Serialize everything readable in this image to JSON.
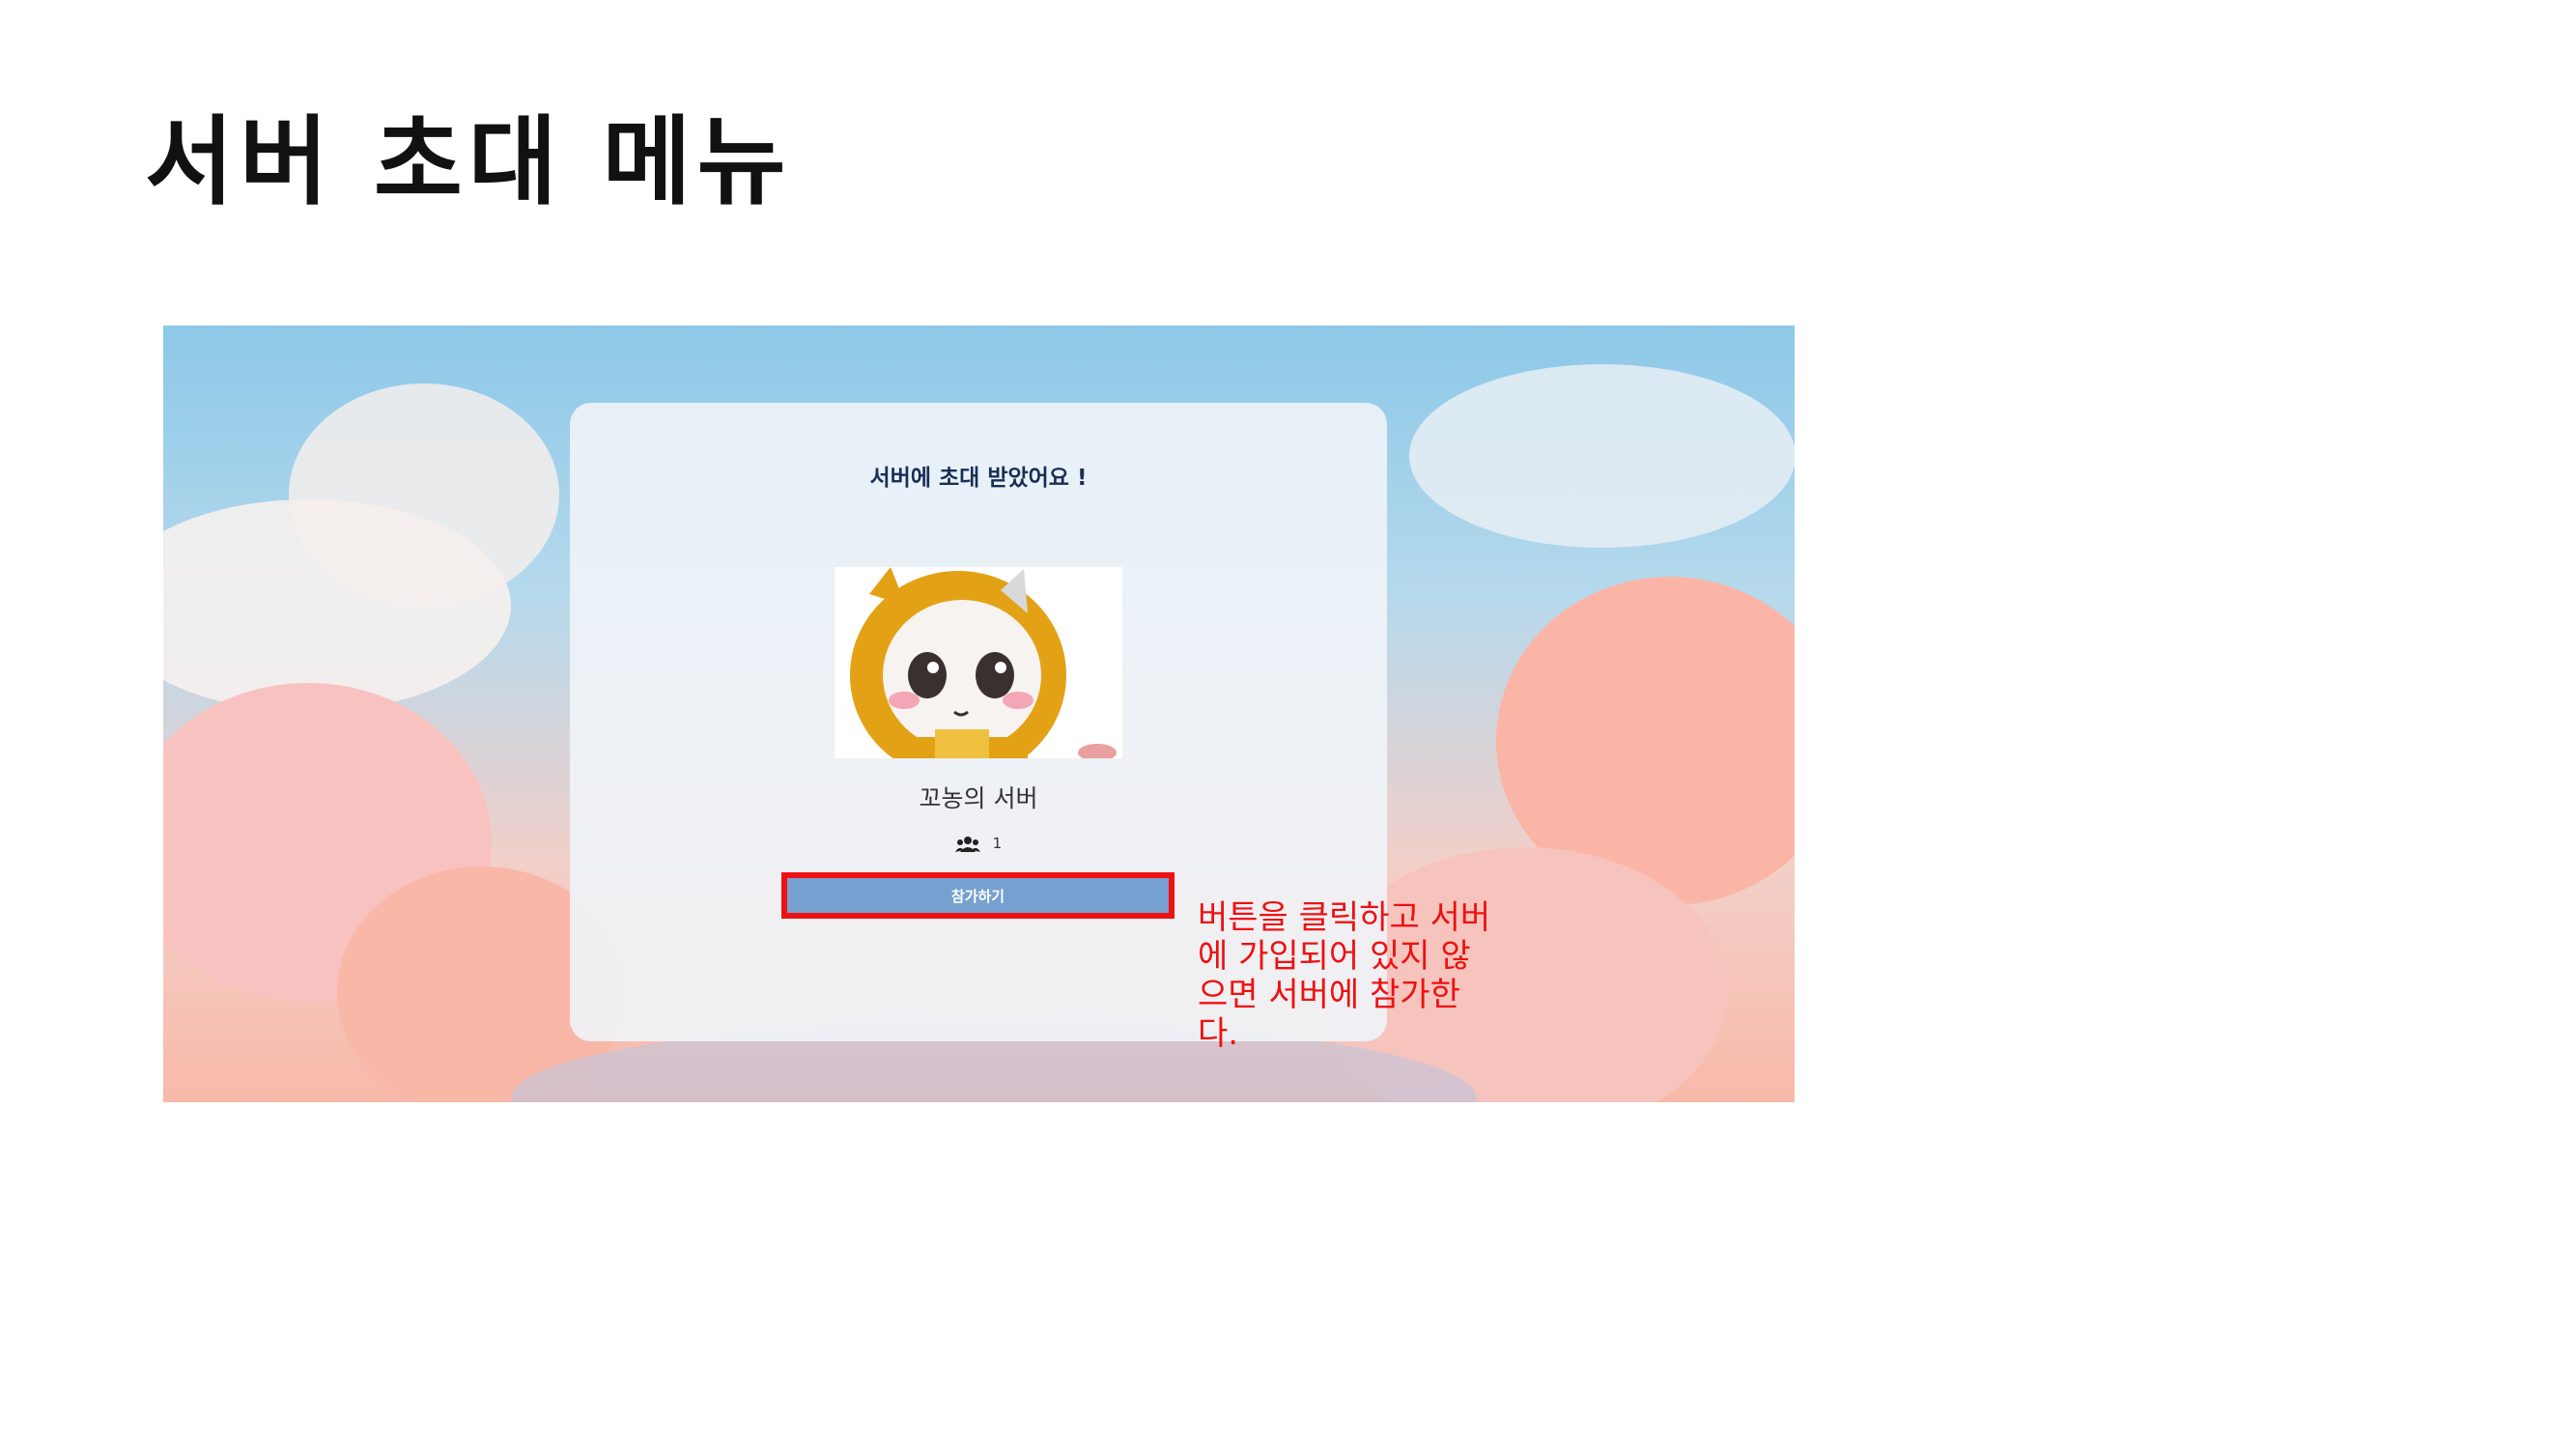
{
  "slide": {
    "title": "서버 초대 메뉴",
    "annotation": "버튼을 클릭하고 서버에 가입되어 있지 않으면 서버에 참가한다."
  },
  "invite_card": {
    "heading": "서버에 초대 받았어요 !",
    "server_name": "꼬농의 서버",
    "member_count": "1",
    "join_button_label": "참가하기"
  },
  "colors": {
    "accent_button": "#76a0d0",
    "highlight_border": "#ee1111",
    "annotation_text": "#ee1111",
    "heading_text": "#1b2d55"
  }
}
